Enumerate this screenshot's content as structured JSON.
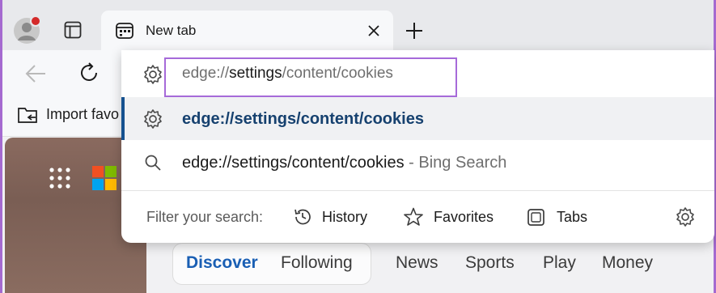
{
  "tab": {
    "title": "New tab"
  },
  "favorites_bar": {
    "import_label": "Import favo"
  },
  "address_bar": {
    "value_prefix": "edge://",
    "value_highlight": "settings",
    "value_suffix": "/content/cookies"
  },
  "suggestions": [
    {
      "text": "edge://settings/content/cookies",
      "icon": "gear-icon"
    },
    {
      "text": "edge://settings/content/cookies",
      "source": " - Bing Search",
      "icon": "search-icon"
    }
  ],
  "filter": {
    "label": "Filter your search:",
    "chips": [
      {
        "label": "History",
        "icon": "history-icon"
      },
      {
        "label": "Favorites",
        "icon": "star-icon"
      },
      {
        "label": "Tabs",
        "icon": "tabs-icon"
      }
    ]
  },
  "feed_nav": {
    "tabs": [
      "Discover",
      "Following",
      "News",
      "Sports",
      "Play",
      "Money"
    ]
  },
  "colors": {
    "accent_outline": "#a66ad9",
    "selected_text": "#16416f",
    "discover_tab": "#1a5fb4",
    "window_border": "#a56ad0"
  }
}
